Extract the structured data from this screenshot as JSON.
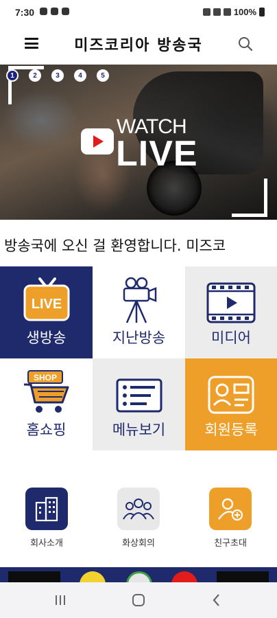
{
  "status_bar": {
    "time": "7:30",
    "battery": "100%"
  },
  "header": {
    "title": "미즈코리아 방송국",
    "menu_icon": "hamburger-menu-icon",
    "search_icon": "search-icon"
  },
  "banner": {
    "dots": [
      "1",
      "2",
      "3",
      "4",
      "5"
    ],
    "active_dot": 0,
    "watch": "WATCH",
    "live": "LIVE"
  },
  "marquee": {
    "text": "방송국에 오신 걸 환영합니다. 미즈코"
  },
  "menu": [
    {
      "label": "생방송",
      "icon": "live-tv-icon"
    },
    {
      "label": "지난방송",
      "icon": "movie-camera-icon"
    },
    {
      "label": "미디어",
      "icon": "film-play-icon"
    },
    {
      "label": "홈쇼핑",
      "icon": "shop-cart-icon"
    },
    {
      "label": "메뉴보기",
      "icon": "list-menu-icon"
    },
    {
      "label": "회원등록",
      "icon": "member-card-icon"
    }
  ],
  "shortcuts": [
    {
      "label": "회사소개",
      "icon": "building-icon"
    },
    {
      "label": "화상회의",
      "icon": "group-people-icon"
    },
    {
      "label": "친구초대",
      "icon": "add-friend-icon"
    }
  ],
  "colors": {
    "navy": "#1f2a6c",
    "orange": "#ee9f2a",
    "gray": "#ececec",
    "red": "#e21b1b"
  }
}
